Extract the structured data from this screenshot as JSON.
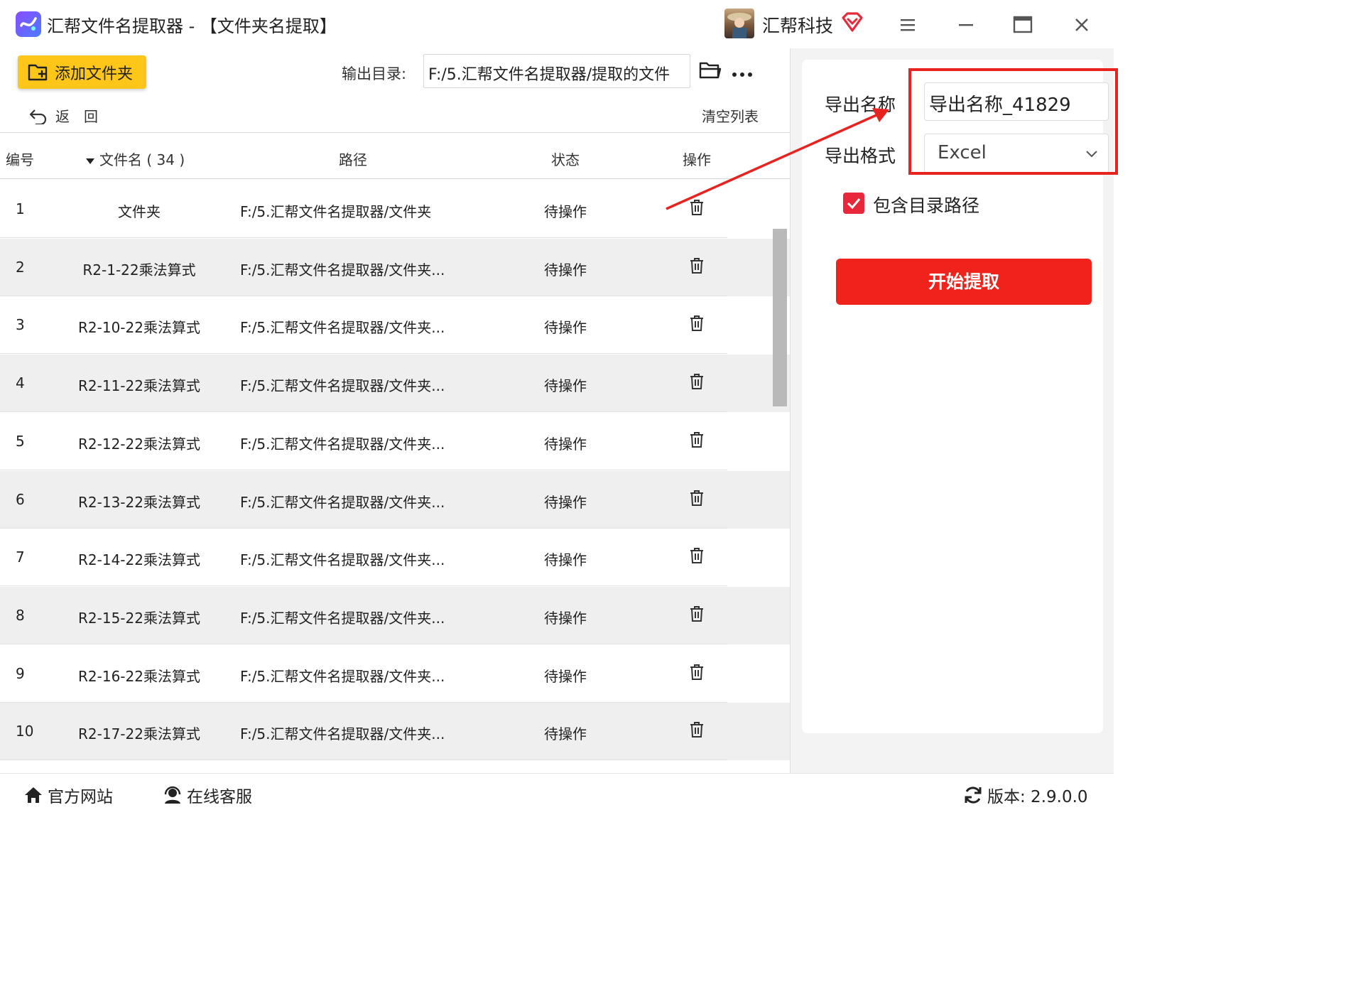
{
  "titlebar": {
    "app_title": "汇帮文件名提取器 - 【文件夹名提取】",
    "brand": "汇帮科技"
  },
  "toolbar": {
    "add_folder_label": "添加文件夹",
    "output_label": "输出目录:",
    "output_path": "F:/5.汇帮文件名提取器/提取的文件",
    "back_label": "返回",
    "clear_label": "清空列表"
  },
  "table": {
    "headers": {
      "num": "编号",
      "name": "文件名 ( 34 )",
      "path": "路径",
      "status": "状态",
      "action": "操作"
    },
    "rows": [
      {
        "num": "1",
        "name": "文件夹",
        "path": "F:/5.汇帮文件名提取器/文件夹",
        "status": "待操作"
      },
      {
        "num": "2",
        "name": "R2-1-22乘法算式",
        "path": "F:/5.汇帮文件名提取器/文件夹...",
        "status": "待操作"
      },
      {
        "num": "3",
        "name": "R2-10-22乘法算式",
        "path": "F:/5.汇帮文件名提取器/文件夹...",
        "status": "待操作"
      },
      {
        "num": "4",
        "name": "R2-11-22乘法算式",
        "path": "F:/5.汇帮文件名提取器/文件夹...",
        "status": "待操作"
      },
      {
        "num": "5",
        "name": "R2-12-22乘法算式",
        "path": "F:/5.汇帮文件名提取器/文件夹...",
        "status": "待操作"
      },
      {
        "num": "6",
        "name": "R2-13-22乘法算式",
        "path": "F:/5.汇帮文件名提取器/文件夹...",
        "status": "待操作"
      },
      {
        "num": "7",
        "name": "R2-14-22乘法算式",
        "path": "F:/5.汇帮文件名提取器/文件夹...",
        "status": "待操作"
      },
      {
        "num": "8",
        "name": "R2-15-22乘法算式",
        "path": "F:/5.汇帮文件名提取器/文件夹...",
        "status": "待操作"
      },
      {
        "num": "9",
        "name": "R2-16-22乘法算式",
        "path": "F:/5.汇帮文件名提取器/文件夹...",
        "status": "待操作"
      },
      {
        "num": "10",
        "name": "R2-17-22乘法算式",
        "path": "F:/5.汇帮文件名提取器/文件夹...",
        "status": "待操作"
      }
    ]
  },
  "settings": {
    "export_name_label": "导出名称",
    "export_name_value": "导出名称_41829",
    "export_format_label": "导出格式",
    "export_format_value": "Excel",
    "include_path_label": "包含目录路径",
    "include_path_checked": true,
    "start_label": "开始提取"
  },
  "footer": {
    "website_label": "官方网站",
    "support_label": "在线客服",
    "version_label": "版本: 2.9.0.0"
  },
  "colors": {
    "accent_yellow": "#ffc61a",
    "accent_red": "#f0231c",
    "annotation_red": "#e8231f",
    "row_alt": "#efefef"
  }
}
